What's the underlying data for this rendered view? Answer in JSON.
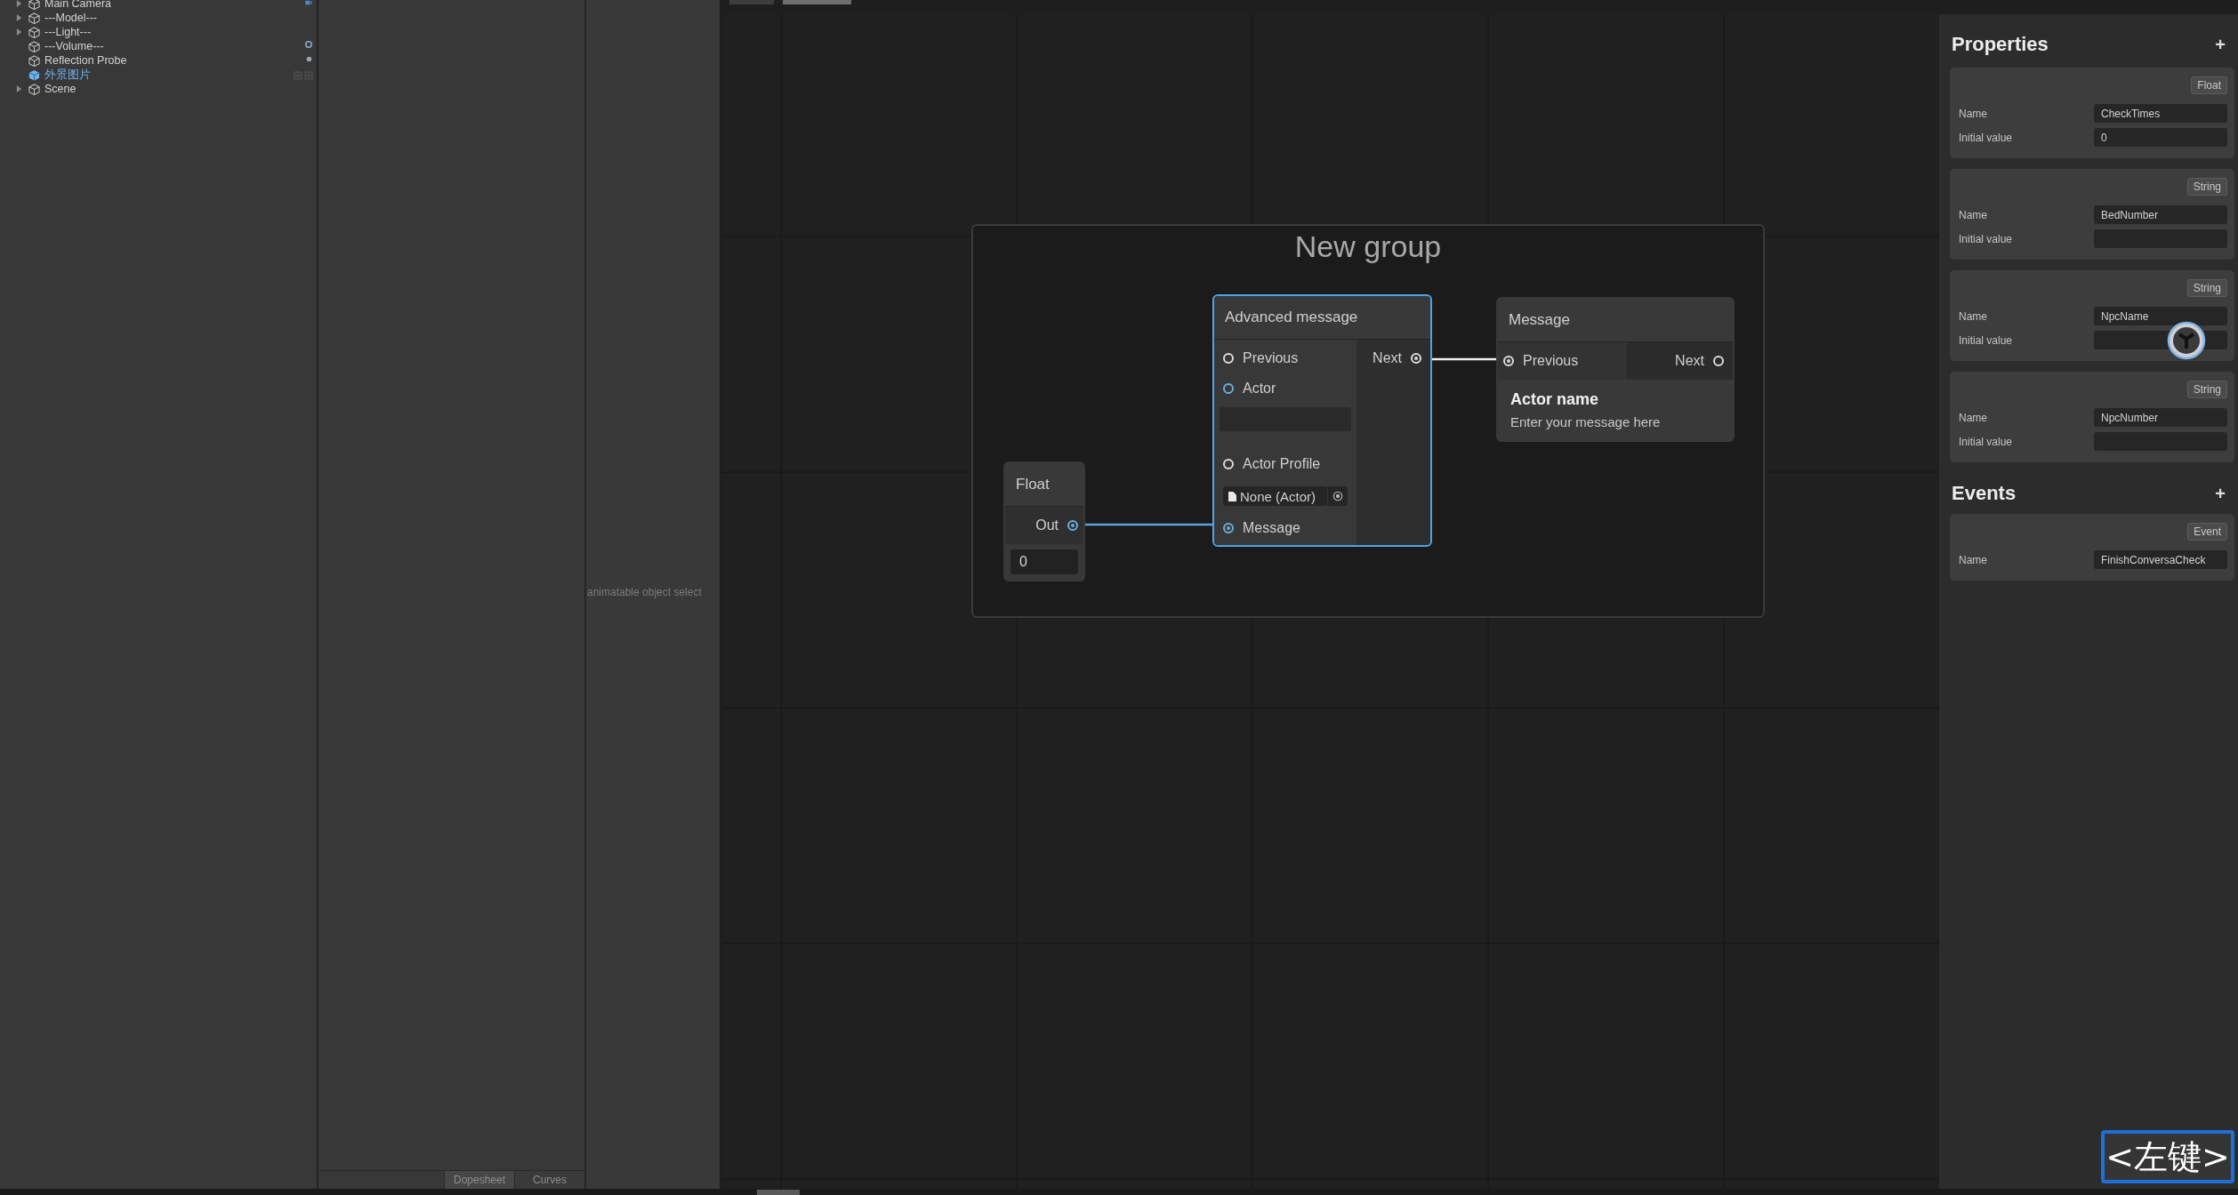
{
  "hierarchy": {
    "items": [
      {
        "label": "Main Camera",
        "foldout": true,
        "kind": "object"
      },
      {
        "label": "---Model---",
        "foldout": true,
        "kind": "object"
      },
      {
        "label": "---Light---",
        "foldout": true,
        "kind": "object"
      },
      {
        "label": "---Volume---",
        "foldout": false,
        "kind": "object"
      },
      {
        "label": "Reflection Probe",
        "foldout": false,
        "kind": "object"
      },
      {
        "label": "外景图片",
        "foldout": false,
        "kind": "prefab"
      },
      {
        "label": "Scene",
        "foldout": true,
        "kind": "object"
      }
    ]
  },
  "animation": {
    "hint": "animatable object select",
    "tabs": [
      {
        "label": "Dopesheet",
        "selected": true
      },
      {
        "label": "Curves",
        "selected": false
      }
    ]
  },
  "graph": {
    "group_title": "New group",
    "float_node": {
      "title": "Float",
      "output": {
        "label": "Out",
        "connected": true,
        "color": "#6aaee0"
      },
      "value": "0"
    },
    "advanced_node": {
      "title": "Advanced message",
      "selected": true,
      "inputs": [
        {
          "kind": "port",
          "label": "Previous",
          "connected": false,
          "color": "#dcdcdc"
        },
        {
          "kind": "port",
          "label": "Actor",
          "connected": false,
          "color": "#6aaee0"
        },
        {
          "kind": "text_field"
        },
        {
          "kind": "port",
          "label": "Actor Profile",
          "connected": false,
          "color": "#dcdcdc"
        },
        {
          "kind": "object_field",
          "value": "None (Actor)"
        },
        {
          "kind": "port",
          "label": "Message",
          "connected": true,
          "color": "#6aaee0"
        }
      ],
      "outputs": [
        {
          "label": "Next",
          "connected": true,
          "color": "#dcdcdc"
        }
      ]
    },
    "message_node": {
      "title": "Message",
      "selected": false,
      "inputs": [
        {
          "label": "Previous",
          "connected": true,
          "color": "#dcdcdc"
        }
      ],
      "outputs": [
        {
          "label": "Next",
          "connected": false,
          "color": "#dcdcdc"
        }
      ],
      "actor": "Actor name",
      "text": "Enter your message here"
    }
  },
  "blackboard": {
    "properties_title": "Properties",
    "events_title": "Events",
    "add_symbol": "+",
    "properties": [
      {
        "type": "Float",
        "fields": [
          {
            "label": "Name",
            "value": "CheckTimes"
          },
          {
            "label": "Initial value",
            "value": "0"
          }
        ]
      },
      {
        "type": "String",
        "fields": [
          {
            "label": "Name",
            "value": "BedNumber"
          },
          {
            "label": "Initial value"
          }
        ]
      },
      {
        "type": "String",
        "fields": [
          {
            "label": "Name",
            "value": "NpcName"
          },
          {
            "label": "Initial value"
          }
        ]
      },
      {
        "type": "String",
        "fields": [
          {
            "label": "Name",
            "value": "NpcNumber"
          },
          {
            "label": "Initial value"
          }
        ]
      }
    ],
    "events": [
      {
        "type": "Event",
        "fields": [
          {
            "label": "Name",
            "value": "FinishConversaCheck"
          }
        ]
      }
    ]
  },
  "key_overlay": "<左键>"
}
